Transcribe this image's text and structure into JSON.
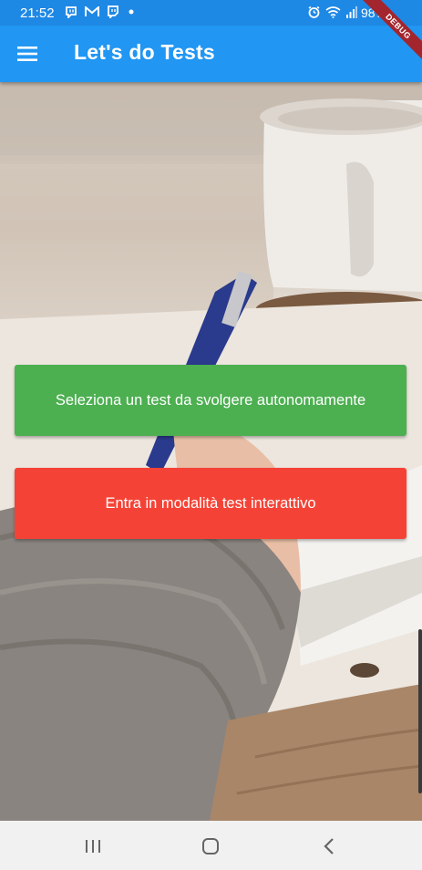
{
  "status_bar": {
    "time": "21:52",
    "battery": "98%",
    "left_icons": [
      "chat-bubble-icon",
      "gmail-icon",
      "twitch-icon",
      "dot-icon"
    ],
    "right_icons": [
      "alarm-icon",
      "wifi-icon",
      "signal-icon"
    ]
  },
  "app_bar": {
    "title": "Let's do Tests",
    "color": "#2196f3",
    "menu_icon": "hamburger-menu-icon"
  },
  "debug_banner": {
    "label": "DEBUG",
    "color": "#a3262f"
  },
  "actions": [
    {
      "label": "Seleziona un test da svolgere autonomamente",
      "color": "#4caf50"
    },
    {
      "label": "Entra in modalità test interattivo",
      "color": "#f44336"
    }
  ],
  "nav_bar": {
    "buttons": [
      "recent-apps-icon",
      "home-icon",
      "back-icon"
    ]
  }
}
